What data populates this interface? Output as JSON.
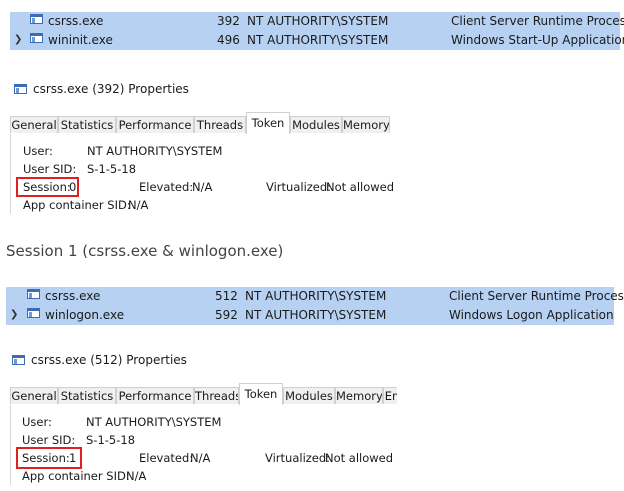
{
  "session0": {
    "processes": [
      {
        "name": "csrss.exe",
        "pid": "392",
        "user": "NT AUTHORITY\\SYSTEM",
        "description": "Client Server Runtime Process",
        "expanded": false
      },
      {
        "name": "wininit.exe",
        "pid": "496",
        "user": "NT AUTHORITY\\SYSTEM",
        "description": "Windows Start-Up Application",
        "expanded": true
      }
    ],
    "window_title": "csrss.exe (392) Properties",
    "tabs": [
      "General",
      "Statistics",
      "Performance",
      "Threads",
      "Token",
      "Modules",
      "Memory",
      "E"
    ],
    "active_tab": "Token",
    "token": {
      "user_label": "User:",
      "user_value": "NT AUTHORITY\\SYSTEM",
      "sid_label": "User SID:",
      "sid_value": "S-1-5-18",
      "session_label": "Session:",
      "session_value": "0",
      "elevated_label": "Elevated:",
      "elevated_value": "N/A",
      "virtualized_label": "Virtualized:",
      "virtualized_value": "Not allowed",
      "appcontainer_label": "App container SID:",
      "appcontainer_value": "N/A"
    }
  },
  "session1_heading": "Session 1 (csrss.exe & winlogon.exe)",
  "session1": {
    "processes": [
      {
        "name": "csrss.exe",
        "pid": "512",
        "user": "NT AUTHORITY\\SYSTEM",
        "description": "Client Server Runtime Process",
        "expanded": false
      },
      {
        "name": "winlogon.exe",
        "pid": "592",
        "user": "NT AUTHORITY\\SYSTEM",
        "description": "Windows Logon Application",
        "expanded": true
      }
    ],
    "window_title": "csrss.exe (512) Properties",
    "tabs": [
      "General",
      "Statistics",
      "Performance",
      "Threads",
      "Token",
      "Modules",
      "Memory",
      "En"
    ],
    "active_tab": "Token",
    "token": {
      "user_label": "User:",
      "user_value": "NT AUTHORITY\\SYSTEM",
      "sid_label": "User SID:",
      "sid_value": "S-1-5-18",
      "session_label": "Session:",
      "session_value": "1",
      "elevated_label": "Elevated:",
      "elevated_value": "N/A",
      "virtualized_label": "Virtualized:",
      "virtualized_value": "Not allowed",
      "appcontainer_label": "App container SID:",
      "appcontainer_value": "N/A"
    }
  },
  "colors": {
    "selection": "#b7d1f2",
    "highlight_box": "#e02020"
  },
  "icons": {
    "process": "window-icon",
    "expand": "chevron-down-icon"
  }
}
